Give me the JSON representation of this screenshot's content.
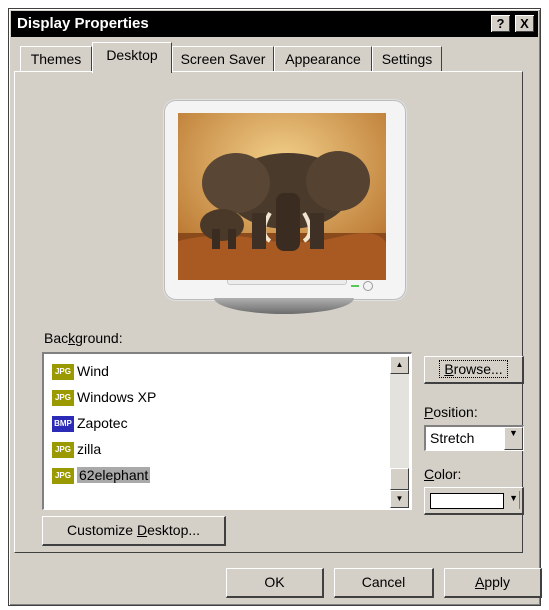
{
  "window": {
    "title": "Display Properties",
    "help_glyph": "?",
    "close_glyph": "X"
  },
  "tabs": [
    {
      "label": "Themes"
    },
    {
      "label": "Desktop"
    },
    {
      "label": "Screen Saver"
    },
    {
      "label": "Appearance"
    },
    {
      "label": "Settings"
    }
  ],
  "background": {
    "label_pre": "Bac",
    "label_key": "k",
    "label_post": "ground:",
    "items": [
      {
        "name": "Wind",
        "type": "JPG"
      },
      {
        "name": "Windows XP",
        "type": "JPG"
      },
      {
        "name": "Zapotec",
        "type": "BMP"
      },
      {
        "name": "zilla",
        "type": "JPG"
      },
      {
        "name": "62elephant",
        "type": "JPG",
        "selected": true
      }
    ]
  },
  "browse": {
    "key": "B",
    "rest": "rowse..."
  },
  "position": {
    "label_key": "P",
    "label_rest": "osition:",
    "value": "Stretch"
  },
  "color": {
    "label_key": "C",
    "label_rest": "olor:",
    "value": "#ffffff"
  },
  "customize": {
    "pre": "Customize ",
    "key": "D",
    "post": "esktop..."
  },
  "ok_label": "OK",
  "cancel_label": "Cancel",
  "apply": {
    "key": "A",
    "rest": "pply"
  },
  "colors": {
    "titlebar": "#000000",
    "face": "#d4d0c8",
    "selection": "#a9a9a9"
  }
}
